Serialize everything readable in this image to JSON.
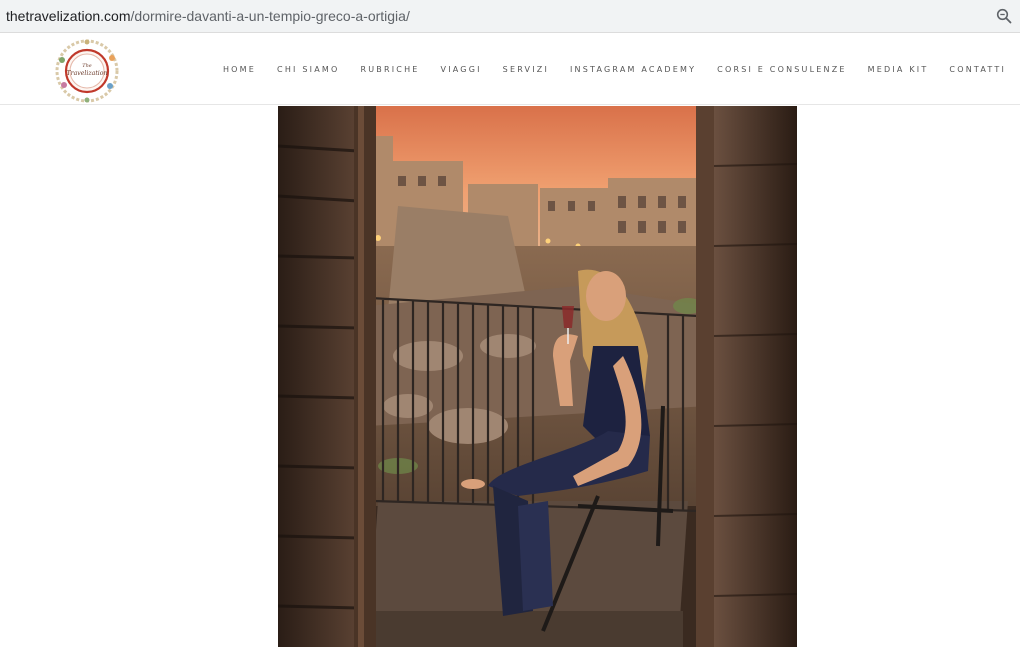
{
  "browser": {
    "url_domain": "thetravelization.com",
    "url_path": "/dormire-davanti-a-un-tempio-greco-a-ortigia/",
    "zoom_icon": "zoom-magnifier-icon"
  },
  "site": {
    "logo_text": "The Travelization",
    "nav": [
      "HOME",
      "CHI SIAMO",
      "RUBRICHE",
      "VIAGGI",
      "SERVIZI",
      "INSTAGRAM ACADEMY",
      "CORSI E CONSULENZE",
      "MEDIA KIT",
      "CONTATTI"
    ]
  },
  "colors": {
    "sky_top": "#e07a4a",
    "sky_bottom": "#f0a070",
    "accent_logo": "#c0392b"
  }
}
